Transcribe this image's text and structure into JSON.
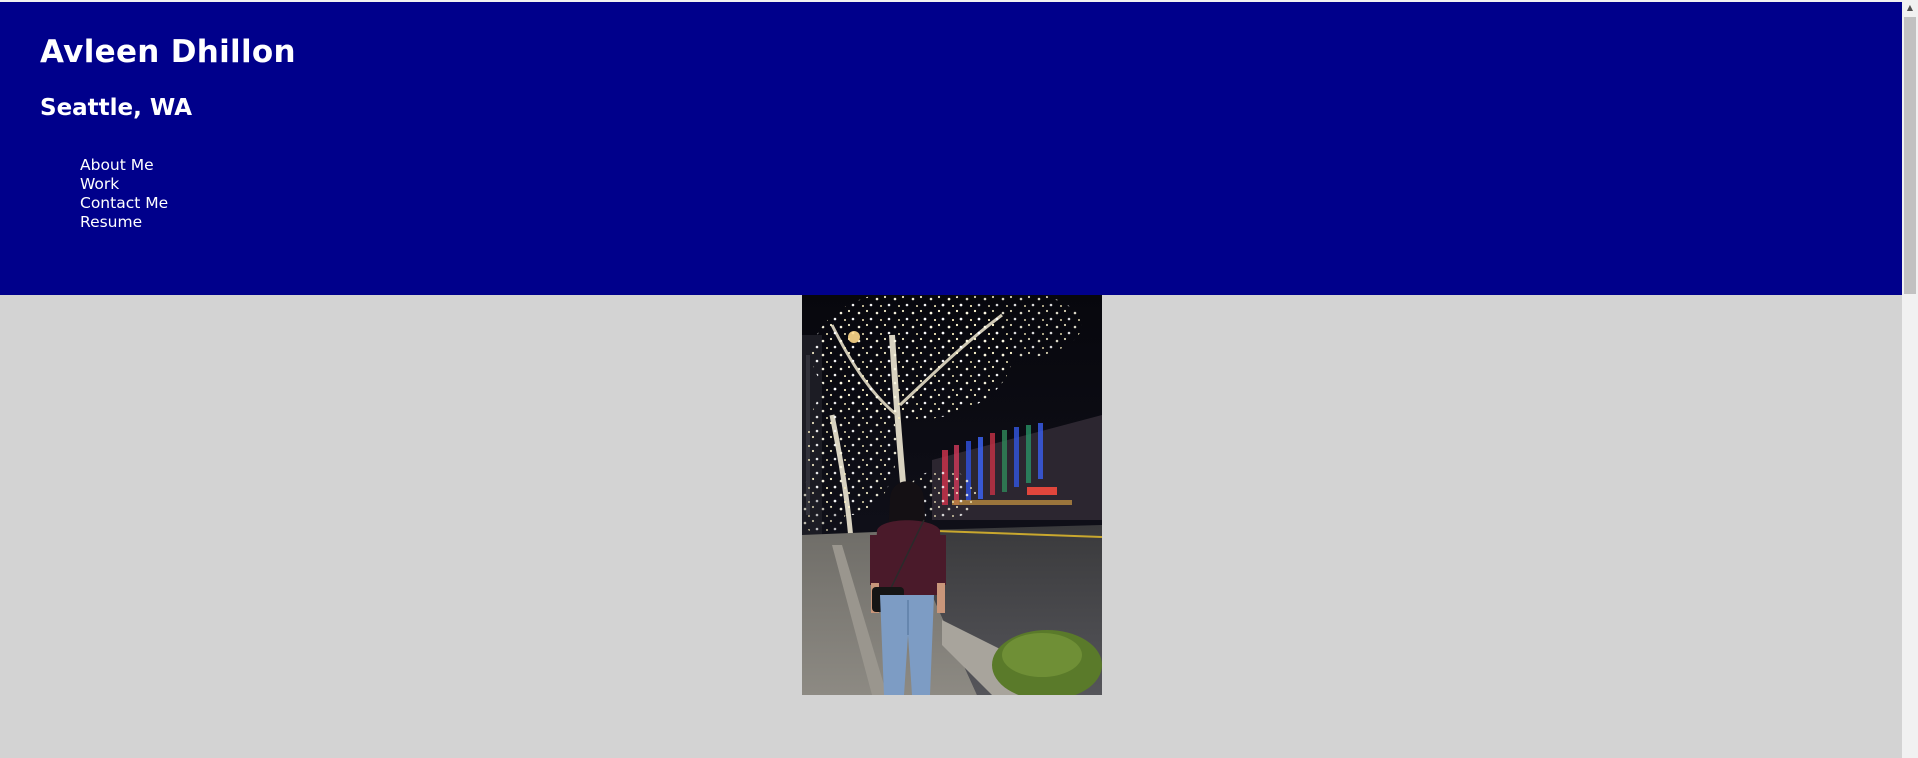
{
  "header": {
    "name": "Avleen Dhillon",
    "location": "Seattle, WA"
  },
  "nav": {
    "items": [
      {
        "label": "About Me"
      },
      {
        "label": "Work"
      },
      {
        "label": "Contact Me"
      },
      {
        "label": "Resume"
      }
    ]
  },
  "colors": {
    "header_background": "#00008b",
    "page_background": "#d3d3d3",
    "header_text": "#ffffff"
  },
  "icons": {
    "scroll_up": "scroll-up-arrow-icon"
  }
}
